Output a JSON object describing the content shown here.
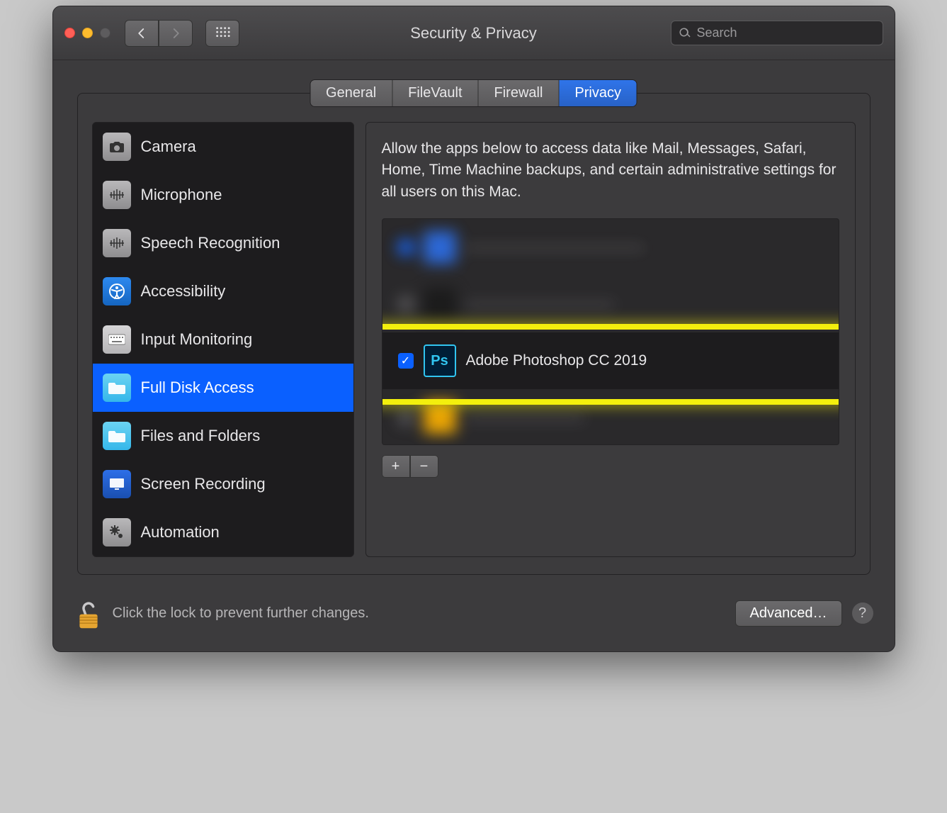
{
  "toolbar": {
    "title": "Security & Privacy",
    "search_placeholder": "Search"
  },
  "tabs": [
    {
      "label": "General",
      "active": false
    },
    {
      "label": "FileVault",
      "active": false
    },
    {
      "label": "Firewall",
      "active": false
    },
    {
      "label": "Privacy",
      "active": true
    }
  ],
  "sidebar": {
    "items": [
      {
        "label": "Camera"
      },
      {
        "label": "Microphone"
      },
      {
        "label": "Speech Recognition"
      },
      {
        "label": "Accessibility"
      },
      {
        "label": "Input Monitoring"
      },
      {
        "label": "Full Disk Access"
      },
      {
        "label": "Files and Folders"
      },
      {
        "label": "Screen Recording"
      },
      {
        "label": "Automation"
      }
    ],
    "selected_index": 5
  },
  "detail": {
    "description": "Allow the apps below to access data like Mail, Messages, Safari, Home, Time Machine backups, and certain administrative settings for all users on this Mac.",
    "apps": [
      {
        "name": "Adobe Photoshop CC 2019",
        "checked": true,
        "highlighted": true
      }
    ],
    "add_label": "+",
    "remove_label": "−"
  },
  "footer": {
    "lock_text": "Click the lock to prevent further changes.",
    "advanced_label": "Advanced…",
    "help_label": "?"
  }
}
